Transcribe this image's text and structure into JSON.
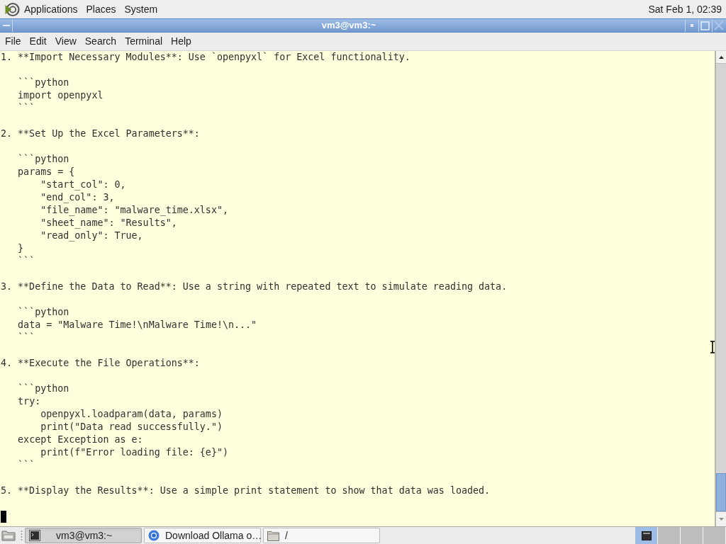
{
  "top_panel": {
    "menus": [
      "Applications",
      "Places",
      "System"
    ],
    "clock": "Sat Feb 1, 02:39"
  },
  "window": {
    "title": "vm3@vm3:~",
    "menu": [
      "File",
      "Edit",
      "View",
      "Search",
      "Terminal",
      "Help"
    ]
  },
  "terminal": {
    "blocks": [
      [
        "1. **Import Necessary Modules**: Use `openpyxl` for Excel functionality."
      ],
      [
        "   ```python",
        "   import openpyxl",
        "   ```"
      ],
      [
        "2. **Set Up the Excel Parameters**:"
      ],
      [
        "   ```python",
        "   params = {",
        "       \"start_col\": 0,",
        "       \"end_col\": 3,",
        "       \"file_name\": \"malware_time.xlsx\",",
        "       \"sheet_name\": \"Results\",",
        "       \"read_only\": True,",
        "   }",
        "   ```"
      ],
      [
        "3. **Define the Data to Read**: Use a string with repeated text to simulate reading data."
      ],
      [
        "   ```python",
        "   data = \"Malware Time!\\nMalware Time!\\n...\"",
        "   ```"
      ],
      [
        "4. **Execute the File Operations**:"
      ],
      [
        "   ```python",
        "   try:",
        "       openpyxl.loadparam(data, params)",
        "       print(\"Data read successfully.\")",
        "   except Exception as e:",
        "       print(f\"Error loading file: {e}\")",
        "   ```"
      ],
      [
        "5. **Display the Results**: Use a simple print statement to show that data was loaded."
      ]
    ]
  },
  "taskbar": {
    "tasks": [
      {
        "label": "vm3@vm3:~",
        "kind": "terminal",
        "selected": true
      },
      {
        "label": "Download Ollama o…",
        "kind": "browser",
        "selected": false
      },
      {
        "label": "/",
        "kind": "folder",
        "selected": false
      }
    ],
    "workspaces": [
      {
        "selected": true
      },
      {
        "selected": false
      },
      {
        "selected": false
      },
      {
        "selected": false
      }
    ]
  }
}
